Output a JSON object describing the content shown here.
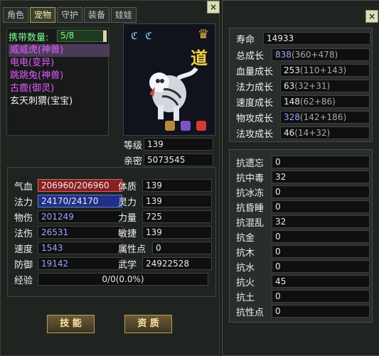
{
  "tabs": [
    {
      "label": "角色"
    },
    {
      "label": "宠物"
    },
    {
      "label": "守护"
    },
    {
      "label": "装备"
    },
    {
      "label": "娃娃"
    }
  ],
  "left": {
    "carry_label": "携带数量:",
    "carry_value": "5/8",
    "pets": [
      {
        "name": "威威虎(神兽)"
      },
      {
        "name": "电电(变异)"
      },
      {
        "name": "跳跳兔(神兽)"
      },
      {
        "name": "古鹿(御灵)"
      },
      {
        "name": "玄天刺猬(宝宝)"
      }
    ],
    "portrait": {
      "sym": "ℭ ℭ",
      "crown": "♛",
      "tao": "道"
    },
    "info": {
      "level_label": "等级",
      "level_value": "139",
      "intimacy_label": "亲密",
      "intimacy_value": "5073545"
    },
    "stats": {
      "qixue_label": "气血",
      "qixue_value": "206960/206960",
      "fali_label": "法力",
      "fali_value": "24170/24170",
      "wushang_label": "物伤",
      "wushang_value": "201249",
      "fashang_label": "法伤",
      "fashang_value": "26531",
      "sudu_label": "速度",
      "sudu_value": "1543",
      "fangyu_label": "防御",
      "fangyu_value": "19142",
      "tizhi_label": "体质",
      "tizhi_value": "139",
      "lingli_label": "灵力",
      "lingli_value": "139",
      "liliang_label": "力量",
      "liliang_value": "725",
      "minjie_label": "敏捷",
      "minjie_value": "139",
      "shuxingdian_label": "属性点",
      "shuxingdian_value": "0",
      "wuxue_label": "武学",
      "wuxue_value": "24922528",
      "jingyan_label": "经验",
      "jingyan_value": "0/0(0.0%)"
    },
    "buttons": {
      "skill": "技 能",
      "aptitude": "资 质"
    }
  },
  "right": {
    "top": {
      "shouming_label": "寿命",
      "shouming_value": "14933",
      "zong_label": "总成长",
      "zong_value": "838",
      "zong_extra": "(360+478)",
      "xueliang_label": "血量成长",
      "xueliang_value": "253",
      "xueliang_extra": "(110+143)",
      "fali_label": "法力成长",
      "fali_value": "63",
      "fali_extra": "(32+31)",
      "sudu_label": "速度成长",
      "sudu_value": "148",
      "sudu_extra": "(62+86)",
      "wugong_label": "物攻成长",
      "wugong_value": "328",
      "wugong_extra": "(142+186)",
      "fagong_label": "法攻成长",
      "fagong_value": "46",
      "fagong_extra": "(14+32)"
    },
    "resist": [
      {
        "label": "抗遗忘",
        "value": "0"
      },
      {
        "label": "抗中毒",
        "value": "32"
      },
      {
        "label": "抗冰冻",
        "value": "0"
      },
      {
        "label": "抗昏睡",
        "value": "0"
      },
      {
        "label": "抗混乱",
        "value": "32"
      },
      {
        "label": "抗金",
        "value": "0"
      },
      {
        "label": "抗木",
        "value": "0"
      },
      {
        "label": "抗水",
        "value": "0"
      },
      {
        "label": "抗火",
        "value": "45"
      },
      {
        "label": "抗土",
        "value": "0"
      },
      {
        "label": "抗性点",
        "value": "0"
      }
    ]
  },
  "colors": {
    "qixue_bar": "#8a1f1f",
    "fali_bar": "#1f2f8a",
    "blue_values": "#9aa6ff",
    "tab_active": "#fff3b0",
    "pet_names": "#e35cff"
  }
}
